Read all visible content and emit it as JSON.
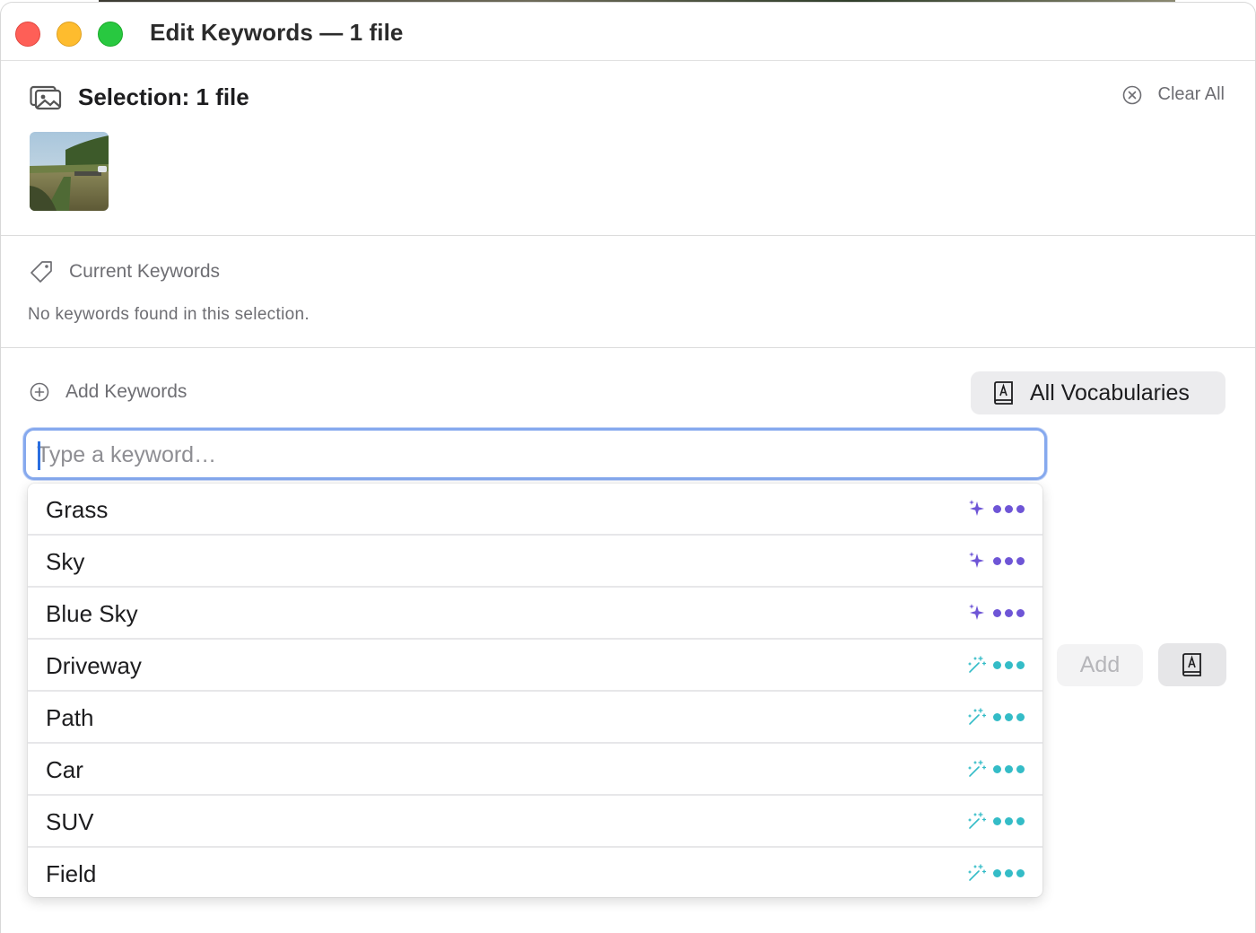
{
  "window": {
    "title": "Edit Keywords — 1 file"
  },
  "selection": {
    "title": "Selection: 1 file",
    "clear_all": "Clear All",
    "thumbnail_alt": "field with path"
  },
  "current_keywords": {
    "header": "Current Keywords",
    "empty_message": "No keywords found in this selection."
  },
  "add_keywords": {
    "header": "Add Keywords",
    "vocabulary_button": "All Vocabularies",
    "input_placeholder": "Type a keyword…",
    "input_value": "",
    "add_button": "Add"
  },
  "suggestions": [
    {
      "label": "Grass",
      "kind": "ai",
      "icon": "sparkle-icon"
    },
    {
      "label": "Sky",
      "kind": "ai",
      "icon": "sparkle-icon"
    },
    {
      "label": "Blue Sky",
      "kind": "ai",
      "icon": "sparkle-icon"
    },
    {
      "label": "Driveway",
      "kind": "magic",
      "icon": "magic-wand-icon"
    },
    {
      "label": "Path",
      "kind": "magic",
      "icon": "magic-wand-icon"
    },
    {
      "label": "Car",
      "kind": "magic",
      "icon": "magic-wand-icon"
    },
    {
      "label": "SUV",
      "kind": "magic",
      "icon": "magic-wand-icon"
    },
    {
      "label": "Field",
      "kind": "magic",
      "icon": "magic-wand-icon"
    }
  ],
  "colors": {
    "ai": "#6e55d6",
    "magic": "#34bcc7",
    "focus_ring": "#86a9ee"
  }
}
